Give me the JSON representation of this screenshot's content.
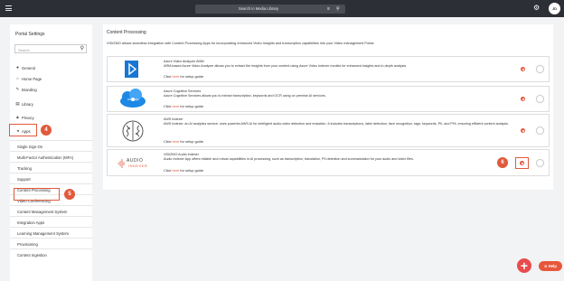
{
  "topbar": {
    "search_placeholder": "Search in Media Library",
    "filter_icon": "filter-icon",
    "search_icon": "search-icon",
    "settings_icon": "settings-gear-icon",
    "avatar_initials": "JD"
  },
  "sidebar": {
    "title": "Portal Settings",
    "search_placeholder": "Search",
    "items": [
      {
        "icon": "info-icon",
        "label": "General"
      },
      {
        "icon": "home-icon",
        "label": "Home Page"
      },
      {
        "icon": "branding-icon",
        "label": "Branding"
      },
      {
        "icon": "library-icon",
        "label": "Library"
      },
      {
        "icon": "lock-icon",
        "label": "Privacy"
      },
      {
        "icon": "apps-icon",
        "label": "Apps"
      }
    ],
    "subitems": [
      "Single Sign-On",
      "Multi-Factor Authentication (MFA)",
      "Tracking",
      "Support",
      "Content Processing",
      "Video Conferencing",
      "Content Management System",
      "Integration Apps",
      "Learning Management System",
      "Provisioning",
      "Content Ingestion"
    ]
  },
  "steps": {
    "apps": "4",
    "content_processing": "5",
    "gear": "6"
  },
  "main": {
    "title": "Content Processing",
    "description": "VIDIZMO allows seamless integration with Content Processing Apps for incorporating enhanced Video Insights and transcription capabilities into your Video management Portal.",
    "cards": [
      {
        "name": "Azure Video Analyzer AMM",
        "description": "ARM-based Azure Video Analyzer allows you to extract the insights from your content using Azure Video Indexer models for enhanced insights and in-depth analysis.",
        "link_prefix": "Click ",
        "link_word": "here",
        "link_suffix": " for setup guide"
      },
      {
        "name": "Azure Cognitive Services",
        "description": "Azure Cognitive Services allows you to extract transcription, keywords and OCR using on premise AI services.",
        "link_prefix": "Click ",
        "link_word": "here",
        "link_suffix": " for setup guide"
      },
      {
        "name": "AWS Indexer",
        "description": "AWS Indexer, an AI analytics service, uses powerful AWS AI for intelligent audio-video detection and redaction. It includes transcriptions, label detection, face recognition, tags, keywords, PII, and PHI, ensuring efficient content analysis.",
        "link_prefix": "Click ",
        "link_word": "here",
        "link_suffix": " for setup guide"
      },
      {
        "name": "VIDIZMO Audio Indexer",
        "description": "Audio Indexer App offers reliable and robust capabilities in AI processing, such as transcription, translation, PII detection and summarization for your audio and video files.",
        "link_prefix": "Click ",
        "link_word": "here",
        "link_suffix": " for setup guide",
        "logo_text_1": "AUDIO",
        "logo_text_2": "INDEXER"
      }
    ]
  },
  "fab_icon": "plus-icon",
  "help_label": "Help",
  "colors": {
    "accent": "#e15a3c",
    "topbar": "#2c2f35"
  }
}
